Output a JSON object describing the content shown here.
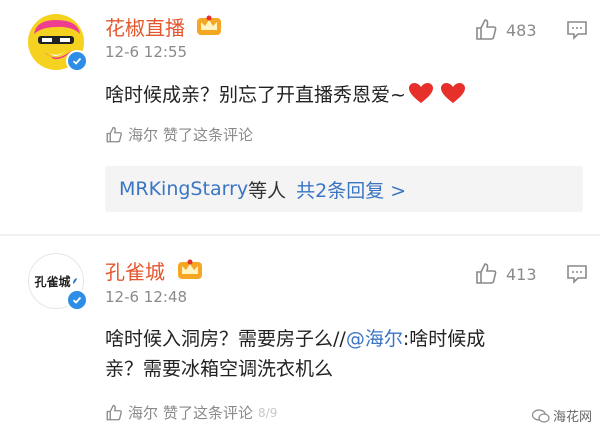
{
  "comments": [
    {
      "username": "花椒直播",
      "time": "12-6 12:55",
      "likes": "483",
      "text": "啥时候成亲？别忘了开直播秀恩爱~",
      "liked_by_user": "海尔",
      "liked_label": "赞了这条评论",
      "replies": {
        "user": "MRKingStarry",
        "mid": "等人",
        "count_label": "共2条回复 >"
      }
    },
    {
      "username": "孔雀城",
      "avatar_text": "孔雀城",
      "time": "12-6 12:48",
      "likes": "413",
      "text_line1_a": "啥时候入洞房？需要房子么//",
      "mention": "@海尔",
      "text_line1_b": ":啥时候成",
      "text_line2": "亲？需要冰箱空调洗衣机么",
      "liked_by_user": "海尔",
      "liked_label": "赞了这条评论",
      "liked_extra": "8/9"
    }
  ],
  "watermark": {
    "label": "海花网"
  },
  "colors": {
    "username": "#e4572e",
    "link": "#3a75c4",
    "meta": "#8a8a8a",
    "verified": "#2e8ee6",
    "heart": "#e8302b"
  }
}
